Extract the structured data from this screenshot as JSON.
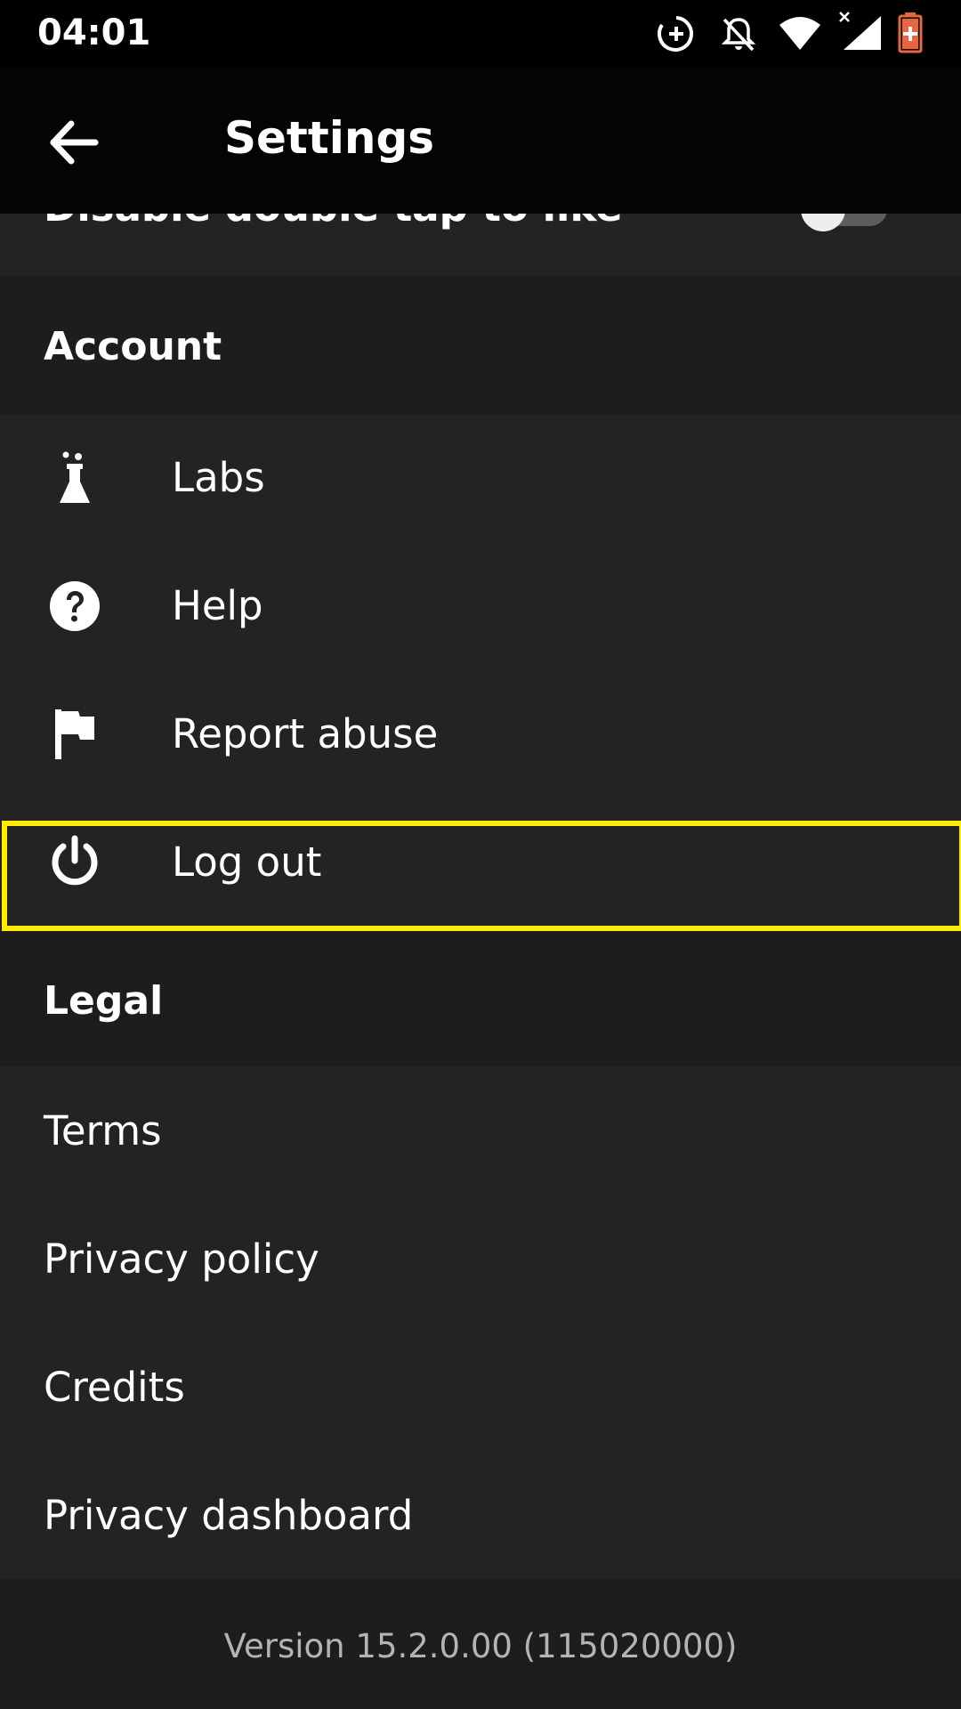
{
  "status_bar": {
    "time": "04:01",
    "icons": [
      "data-saver-icon",
      "notifications-off-icon",
      "wifi-icon",
      "signal-icon",
      "battery-charging-icon"
    ]
  },
  "app_bar": {
    "back_icon": "arrow-left-icon",
    "title": "Settings"
  },
  "display": {
    "partial_item": {
      "label": "Disable double tap to like",
      "toggle_on": false
    }
  },
  "account": {
    "header": "Account",
    "items": [
      {
        "label": "Labs",
        "icon": "flask-icon"
      },
      {
        "label": "Help",
        "icon": "help-circle-icon"
      },
      {
        "label": "Report abuse",
        "icon": "flag-icon"
      },
      {
        "label": "Log out",
        "icon": "power-icon"
      }
    ]
  },
  "legal": {
    "header": "Legal",
    "items": [
      {
        "label": "Terms"
      },
      {
        "label": "Privacy policy"
      },
      {
        "label": "Credits"
      },
      {
        "label": "Privacy dashboard"
      }
    ]
  },
  "footer": {
    "version": "Version 15.2.0.00 (115020000)"
  },
  "colors": {
    "background": "#1e1e1e",
    "row_background": "#232323",
    "header_background": "#1d1d1d",
    "app_bar": "#040404",
    "highlight": "#ffec00",
    "battery": "#e8663d"
  }
}
